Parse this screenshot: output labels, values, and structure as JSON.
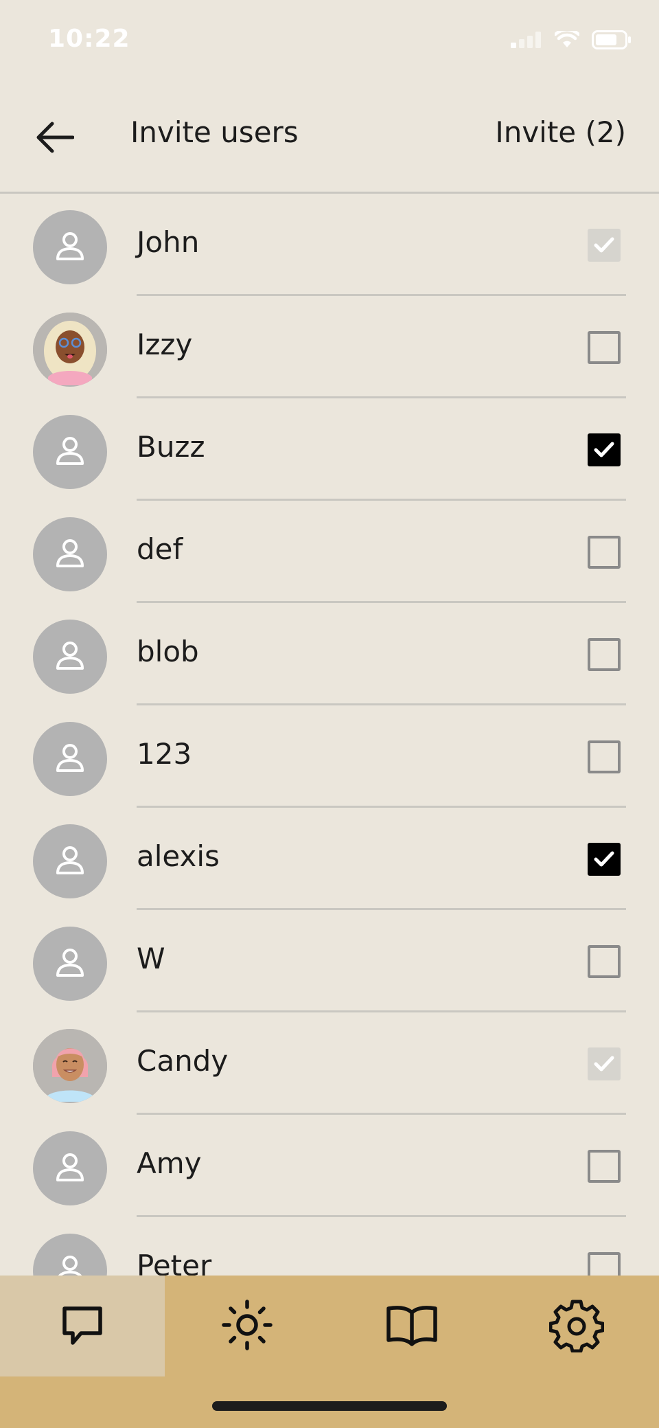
{
  "status_bar": {
    "time": "10:22"
  },
  "header": {
    "title": "Invite users",
    "invite_label": "Invite (2)"
  },
  "users": [
    {
      "name": "John",
      "avatar": "person-icon",
      "state": "disabled-checked"
    },
    {
      "name": "Izzy",
      "avatar": "memoji-izzy",
      "state": "unchecked"
    },
    {
      "name": "Buzz",
      "avatar": "person-icon",
      "state": "checked"
    },
    {
      "name": "def",
      "avatar": "person-icon",
      "state": "unchecked"
    },
    {
      "name": "blob",
      "avatar": "person-icon",
      "state": "unchecked"
    },
    {
      "name": "123",
      "avatar": "person-icon",
      "state": "unchecked"
    },
    {
      "name": "alexis",
      "avatar": "person-icon",
      "state": "checked"
    },
    {
      "name": "W",
      "avatar": "person-icon",
      "state": "unchecked"
    },
    {
      "name": "Candy",
      "avatar": "memoji-candy",
      "state": "disabled-checked"
    },
    {
      "name": "Amy",
      "avatar": "person-icon",
      "state": "unchecked"
    },
    {
      "name": "Peter",
      "avatar": "person-icon",
      "state": "unchecked"
    }
  ],
  "bottom_nav": {
    "items": [
      {
        "icon": "chat-icon",
        "active": true
      },
      {
        "icon": "sun-icon",
        "active": false
      },
      {
        "icon": "book-icon",
        "active": false
      },
      {
        "icon": "settings-gear-icon",
        "active": false
      }
    ]
  },
  "colors": {
    "background": "#ebe6dc",
    "nav_background": "#d4b478",
    "nav_active": "#d9c8a8",
    "avatar_gray": "#b3b3b3",
    "checkbox_checked": "#000000",
    "checkbox_disabled": "#d6d4ce"
  }
}
